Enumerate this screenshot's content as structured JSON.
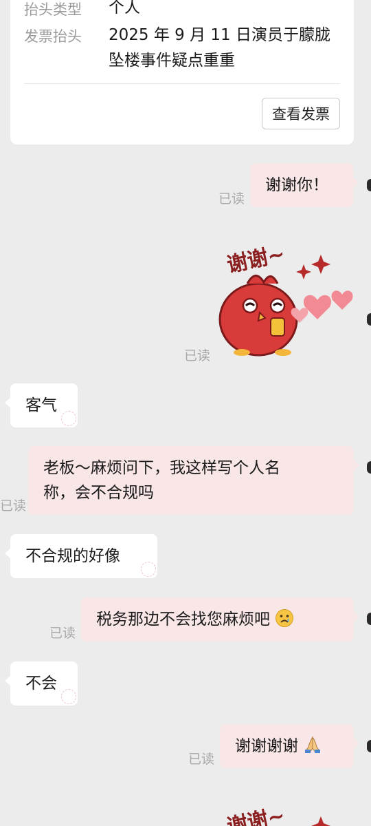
{
  "invoice": {
    "type_label": "抬头类型",
    "type_value": "个人",
    "title_label": "发票抬头",
    "title_value_line1": "2025 年 9 月 11 日演员于朦胧",
    "title_value_line2": "坠楼事件疑点重重",
    "view_button": "查看发票"
  },
  "messages": {
    "m1": "谢谢你！",
    "m2": "客气",
    "m3_line1": "老板～麻烦问下，我这样写个人名",
    "m3_line2": "称，会不合规吗",
    "m4": "不合规的好像",
    "m5": "税务那边不会找您麻烦吧",
    "m6": "不会",
    "m7": "谢谢谢谢"
  },
  "sticker_text": "谢谢~",
  "read_label": "已读",
  "colors": {
    "background": "#ececec",
    "incoming_bubble": "#ffffff",
    "outgoing_bubble": "#f9e6e7",
    "sticker_red": "#d93a3a",
    "heart_pink": "#f28a94"
  },
  "icons": [
    "sad-face-emoji",
    "praying-hands-emoji",
    "bird-sticker",
    "heart-icon",
    "sparkle-icon"
  ]
}
